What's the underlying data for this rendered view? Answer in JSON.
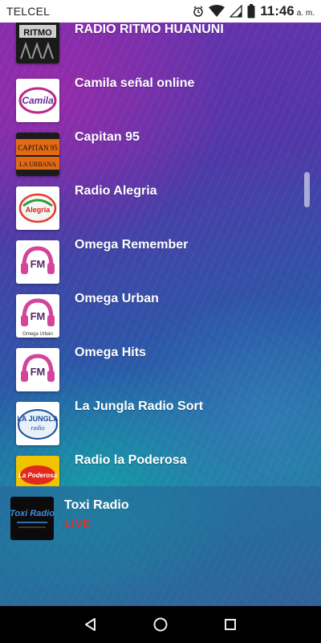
{
  "status_bar": {
    "carrier": "TELCEL",
    "time": "11:46",
    "time_suffix": "a. m.",
    "icons": [
      "alarm-icon",
      "wifi-icon",
      "signal-icon",
      "battery-icon"
    ]
  },
  "stations": [
    {
      "name": "RADIO RITMO HUANUNI",
      "logo_text": "RITMO",
      "logo_icon": "radio-ritmo-logo"
    },
    {
      "name": "Camila señal online",
      "logo_text": "Camila",
      "logo_icon": "camila-logo"
    },
    {
      "name": "Capitan 95",
      "logo_text": "CAPITAN 95",
      "logo_sub": "LA URBANA",
      "logo_icon": "capitan-logo"
    },
    {
      "name": "Radio Alegria",
      "logo_text": "Alegria",
      "logo_icon": "alegria-logo"
    },
    {
      "name": "Omega Remember",
      "logo_text": "FM",
      "logo_icon": "omega-fm-logo"
    },
    {
      "name": "Omega Urban",
      "logo_text": "FM",
      "logo_sub": "Omega Urban",
      "logo_icon": "omega-fm-logo"
    },
    {
      "name": "Omega Hits",
      "logo_text": "FM",
      "logo_icon": "omega-fm-logo"
    },
    {
      "name": "La Jungla Radio Sort",
      "logo_text": "LA JUNGLA",
      "logo_sub": "radio",
      "logo_icon": "jungla-logo"
    },
    {
      "name": "Radio la Poderosa",
      "logo_text": "La Poderosa",
      "logo_icon": "poderosa-logo"
    }
  ],
  "player": {
    "title": "Toxi Radio",
    "status": "LIVE",
    "logo_text": "Toxi Radio",
    "logo_icon": "toxi-radio-logo"
  },
  "nav": {
    "back_icon": "back-icon",
    "home_icon": "home-icon",
    "recents_icon": "recents-icon"
  },
  "colors": {
    "live": "#e0302a",
    "text": "#ffffff",
    "status_bar": "#ffffff",
    "nav_bar": "#000000"
  }
}
